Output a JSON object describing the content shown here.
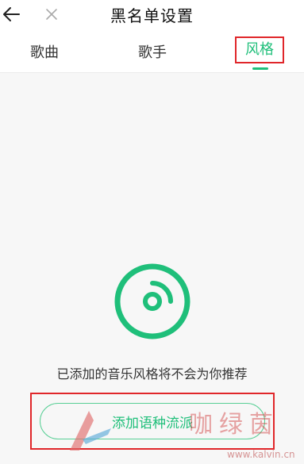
{
  "header": {
    "title": "黑名单设置"
  },
  "tabs": [
    {
      "label": "歌曲"
    },
    {
      "label": "歌手"
    },
    {
      "label": "风格"
    }
  ],
  "active_tab": "风格",
  "empty_state": {
    "message": "已添加的音乐风格将不会为你推荐",
    "button_label": "添加语种流派"
  },
  "watermark": {
    "text": "咖绿茵",
    "url": "www.kalvin.cn"
  },
  "colors": {
    "accent": "#1fbf7a",
    "highlight_box": "#e0262a"
  },
  "icons": {
    "back": "arrow-left-icon",
    "close": "close-icon",
    "empty": "disc-icon"
  }
}
